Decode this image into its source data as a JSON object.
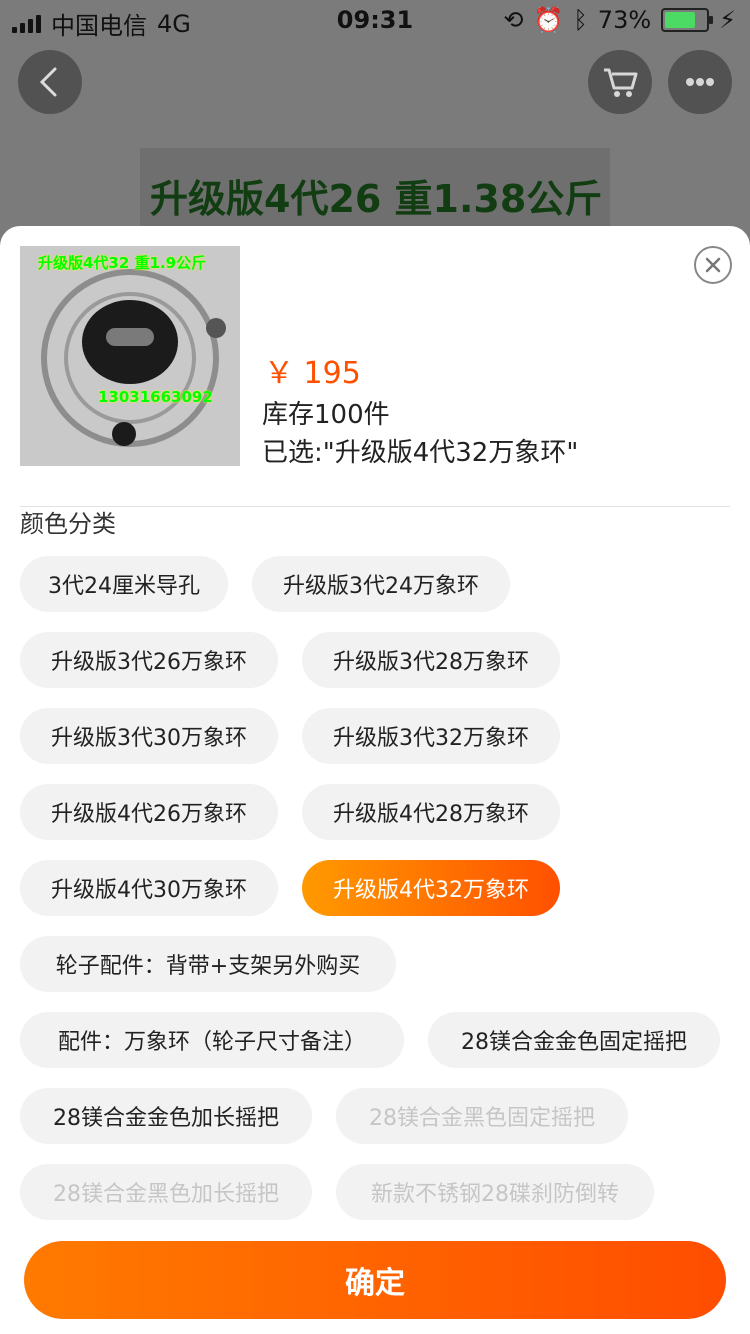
{
  "status": {
    "carrier": "中国电信",
    "network": "4G",
    "time": "09:31",
    "battery": "73%"
  },
  "background": {
    "image_caption": "升级版4代26 重1.38公斤"
  },
  "sheet": {
    "thumb_caption": "升级版4代32 重1.9公斤",
    "thumb_phone": "13031663092",
    "price": "￥ 195",
    "stock": "库存100件",
    "selected_text": "已选:\"升级版4代32万象环\"",
    "section_title": "颜色分类",
    "options": [
      {
        "label": "3代24厘米导孔"
      },
      {
        "label": "升级版3代24万象环"
      },
      {
        "label": "升级版3代26万象环"
      },
      {
        "label": "升级版3代28万象环"
      },
      {
        "label": "升级版3代30万象环"
      },
      {
        "label": "升级版3代32万象环"
      },
      {
        "label": "升级版4代26万象环"
      },
      {
        "label": "升级版4代28万象环"
      },
      {
        "label": "升级版4代30万象环"
      },
      {
        "label": "升级版4代32万象环"
      },
      {
        "label": "轮子配件：背带+支架另外购买"
      },
      {
        "label": "配件：万象环（轮子尺寸备注）"
      },
      {
        "label": "28镁合金金色固定摇把"
      },
      {
        "label": "28镁合金金色加长摇把"
      },
      {
        "label": "28镁合金黑色固定摇把"
      },
      {
        "label": "28镁合金黑色加长摇把"
      },
      {
        "label": "新款不锈钢28碟刹防倒转"
      }
    ],
    "confirm_label": "确定"
  },
  "colors": {
    "accent": "#ff5000",
    "selected_chip_start": "#ff9a00",
    "selected_chip_end": "#ff5000"
  }
}
